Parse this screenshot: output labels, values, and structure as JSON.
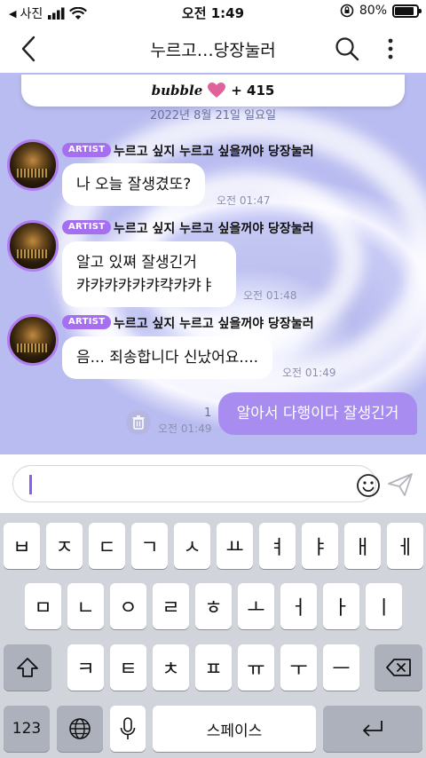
{
  "status_bar": {
    "back_app": "사진",
    "time": "오전 1:49",
    "battery_text": "80%"
  },
  "header": {
    "title": "누르고…당장눌러"
  },
  "banner": {
    "brand": "bubble",
    "count": "+ 415"
  },
  "chat": {
    "date": "2022년 8월 21일 일요일",
    "messages": [
      {
        "tag": "ARTIST",
        "sender": "누르고 싶지 누르고 싶을꺼야 당장눌러",
        "text": "나 오늘 잘생겼또?",
        "time": "오전 01:47"
      },
      {
        "tag": "ARTIST",
        "sender": "누르고 싶지 누르고 싶을꺼야 당장눌러",
        "text_line1": "알고 있쪄 잘생긴거",
        "text_line2": "캬캬캬캬캬캬캭캬캬ㅑ",
        "time": "오전 01:48"
      },
      {
        "tag": "ARTIST",
        "sender": "누르고 싶지 누르고 싶을꺼야 당장눌러",
        "text": "음... 죄송합니다 신났어요....",
        "time": "오전 01:49"
      }
    ],
    "my_message": {
      "text": "알아서 다행이다 잘생긴거",
      "read_count": "1",
      "time": "오전 01:49"
    }
  },
  "input": {
    "placeholder": ""
  },
  "keyboard": {
    "row1": [
      "ㅂ",
      "ㅈ",
      "ㄷ",
      "ㄱ",
      "ㅅ",
      "ㅛ",
      "ㅕ",
      "ㅑ",
      "ㅐ",
      "ㅔ"
    ],
    "row2": [
      "ㅁ",
      "ㄴ",
      "ㅇ",
      "ㄹ",
      "ㅎ",
      "ㅗ",
      "ㅓ",
      "ㅏ",
      "ㅣ"
    ],
    "row3": [
      "ㅋ",
      "ㅌ",
      "ㅊ",
      "ㅍ",
      "ㅠ",
      "ㅜ",
      "ㅡ"
    ],
    "numbers_key": "123",
    "space_key": "스페이스"
  },
  "colors": {
    "accent": "#a98cf0",
    "artist_tag": "#a56ff0",
    "avatar_ring": "#b07cf0"
  },
  "icons": [
    "back-chevron-icon",
    "search-icon",
    "more-vertical-icon",
    "heart-icon",
    "trash-icon",
    "smiley-icon",
    "send-icon",
    "shift-icon",
    "backspace-icon",
    "globe-icon",
    "mic-icon",
    "return-icon"
  ]
}
